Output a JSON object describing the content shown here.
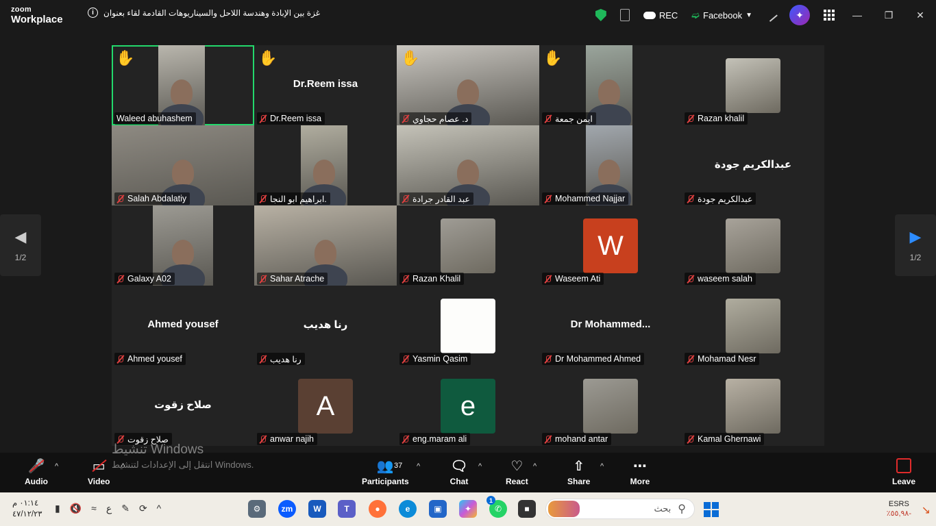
{
  "app": {
    "logo_line1": "zoom",
    "logo_line2": "Workplace",
    "meeting_title": "غزة بين الإبادة وهندسة اللاحل والسيناريوهات القادمة لقاء بعنوان",
    "rec_label": "REC",
    "stream_label": "Facebook"
  },
  "participants": [
    {
      "name": "Waleed abuhashem",
      "type": "video",
      "hand": true,
      "active": true
    },
    {
      "name": "Dr.Reem issa",
      "type": "name",
      "display": "Dr.Reem issa",
      "hand": true
    },
    {
      "name": "د. عصام حجاوي",
      "type": "video",
      "hand": true
    },
    {
      "name": "ايمن جمعة",
      "type": "video",
      "hand": true
    },
    {
      "name": "Razan khalil",
      "type": "photo",
      "hand": false
    },
    {
      "name": "Salah Abdalatiy",
      "type": "video"
    },
    {
      "name": "ابراهيم ابو النجا.",
      "type": "video"
    },
    {
      "name": "عبد القادر جرادة",
      "type": "video"
    },
    {
      "name": "Mohammed Najjar",
      "type": "video"
    },
    {
      "name": "عبدالكريم جودة",
      "type": "name",
      "display": "عبدالكريم جودة"
    },
    {
      "name": "Galaxy A02",
      "type": "video"
    },
    {
      "name": "Sahar Atrache",
      "type": "video"
    },
    {
      "name": "Razan Khalil",
      "type": "photo"
    },
    {
      "name": "Waseem Ati",
      "type": "avatar",
      "letter": "W",
      "color": "#c8401e"
    },
    {
      "name": "waseem salah",
      "type": "photo"
    },
    {
      "name": "Ahmed yousef",
      "type": "name",
      "display": "Ahmed yousef"
    },
    {
      "name": "رنا هديب",
      "type": "name",
      "display": "رنا هديب"
    },
    {
      "name": "Yasmin Qasim",
      "type": "photo"
    },
    {
      "name": "Dr Mohammed Ahmed",
      "type": "name",
      "display": "Dr  Mohammed..."
    },
    {
      "name": "Mohamad Nesr",
      "type": "photo"
    },
    {
      "name": "صلاح زقوت",
      "type": "name",
      "display": "صلاح زقوت"
    },
    {
      "name": "anwar najih",
      "type": "avatar",
      "letter": "A",
      "color": "#5a4033"
    },
    {
      "name": "eng.maram ali",
      "type": "avatar",
      "letter": "e",
      "color": "#0f5a3e"
    },
    {
      "name": "mohand antar",
      "type": "photo"
    },
    {
      "name": "Kamal Ghernawi",
      "type": "photo"
    }
  ],
  "pager": {
    "left": "1/2",
    "right": "1/2"
  },
  "toolbar": {
    "audio": "Audio",
    "video": "Video",
    "participants": "Participants",
    "participants_count": "37",
    "chat": "Chat",
    "react": "React",
    "share": "Share",
    "more": "More",
    "leave": "Leave"
  },
  "watermark": {
    "line1": "تنشيط Windows",
    "line2": "انتقل إلى الإعدادات لتنشيط Windows."
  },
  "taskbar": {
    "time": "٠١:١٤ م",
    "date": "٤٧/١٢/٢٣",
    "lang": "ع",
    "search_placeholder": "بحث",
    "weather_label": "ESRS",
    "weather_value": "٪٥٥,٩٨-",
    "whatsapp_badge": "1",
    "zoom_label": "zm"
  }
}
